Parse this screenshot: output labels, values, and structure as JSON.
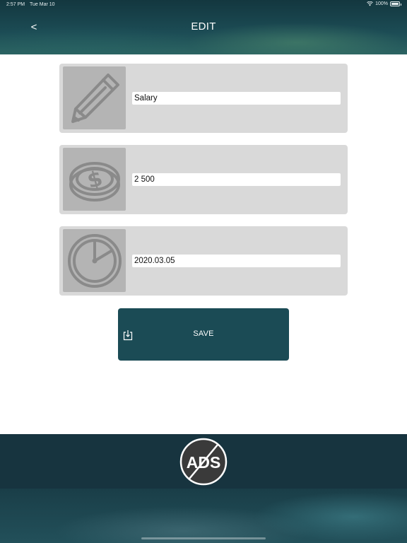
{
  "status_bar": {
    "time": "2:57 PM",
    "date": "Tue Mar 10",
    "battery": "100%"
  },
  "header": {
    "back_label": "<",
    "title": "EDIT"
  },
  "fields": [
    {
      "icon": "pencil-icon",
      "value": "Salary"
    },
    {
      "icon": "coin-dollar-icon",
      "value": "2 500"
    },
    {
      "icon": "clock-icon",
      "value": "2020.03.05"
    }
  ],
  "save_button": {
    "label": "SAVE",
    "icon": "save-download-icon"
  },
  "ads_badge": {
    "label": "ADS",
    "icon": "no-ads-icon"
  },
  "colors": {
    "header": "#1c4c55",
    "card": "#d9d9d9",
    "icon_tile": "#b4b4b4",
    "save": "#1b4b55",
    "ad_banner": "#17343f"
  }
}
